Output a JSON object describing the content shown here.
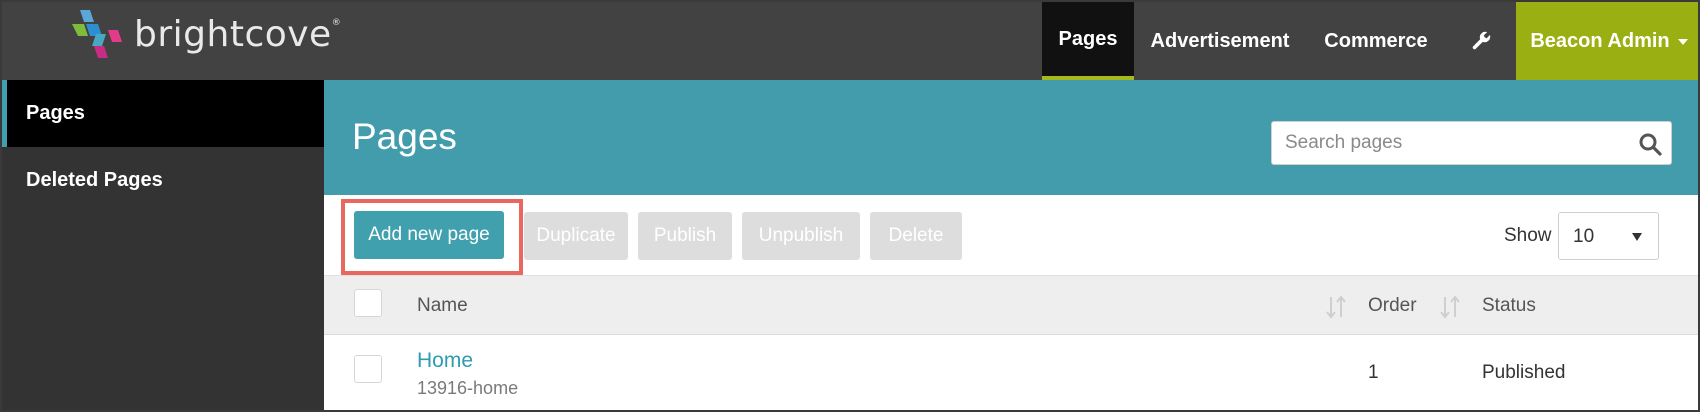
{
  "header": {
    "logo_text": "brightcove",
    "logo_mark": "®",
    "nav": {
      "pages": "Pages",
      "advertisement": "Advertisement",
      "commerce": "Commerce",
      "settings_icon": "wrench-icon",
      "admin": "Beacon Admin"
    }
  },
  "sidebar": {
    "items": [
      {
        "label": "Pages",
        "active": true
      },
      {
        "label": "Deleted Pages",
        "active": false
      }
    ]
  },
  "main": {
    "title": "Pages",
    "search": {
      "placeholder": "Search pages",
      "icon": "search-icon"
    },
    "toolbar": {
      "add": "Add new page",
      "duplicate": "Duplicate",
      "publish": "Publish",
      "unpublish": "Unpublish",
      "delete": "Delete",
      "show_label": "Show",
      "show_value": "10"
    },
    "table": {
      "columns": [
        "Name",
        "Order",
        "Status"
      ],
      "rows": [
        {
          "name": "Home",
          "slug": "13916-home",
          "order": "1",
          "status": "Published"
        }
      ]
    }
  },
  "colors": {
    "topbar": "#424242",
    "active_nav": "#111111",
    "nav_underline": "#a5b81c",
    "admin": "#9aaf12",
    "hero": "#429cab",
    "primary_button": "#41a0ae",
    "highlight_box": "#e8685f",
    "link": "#2f9bb0"
  }
}
